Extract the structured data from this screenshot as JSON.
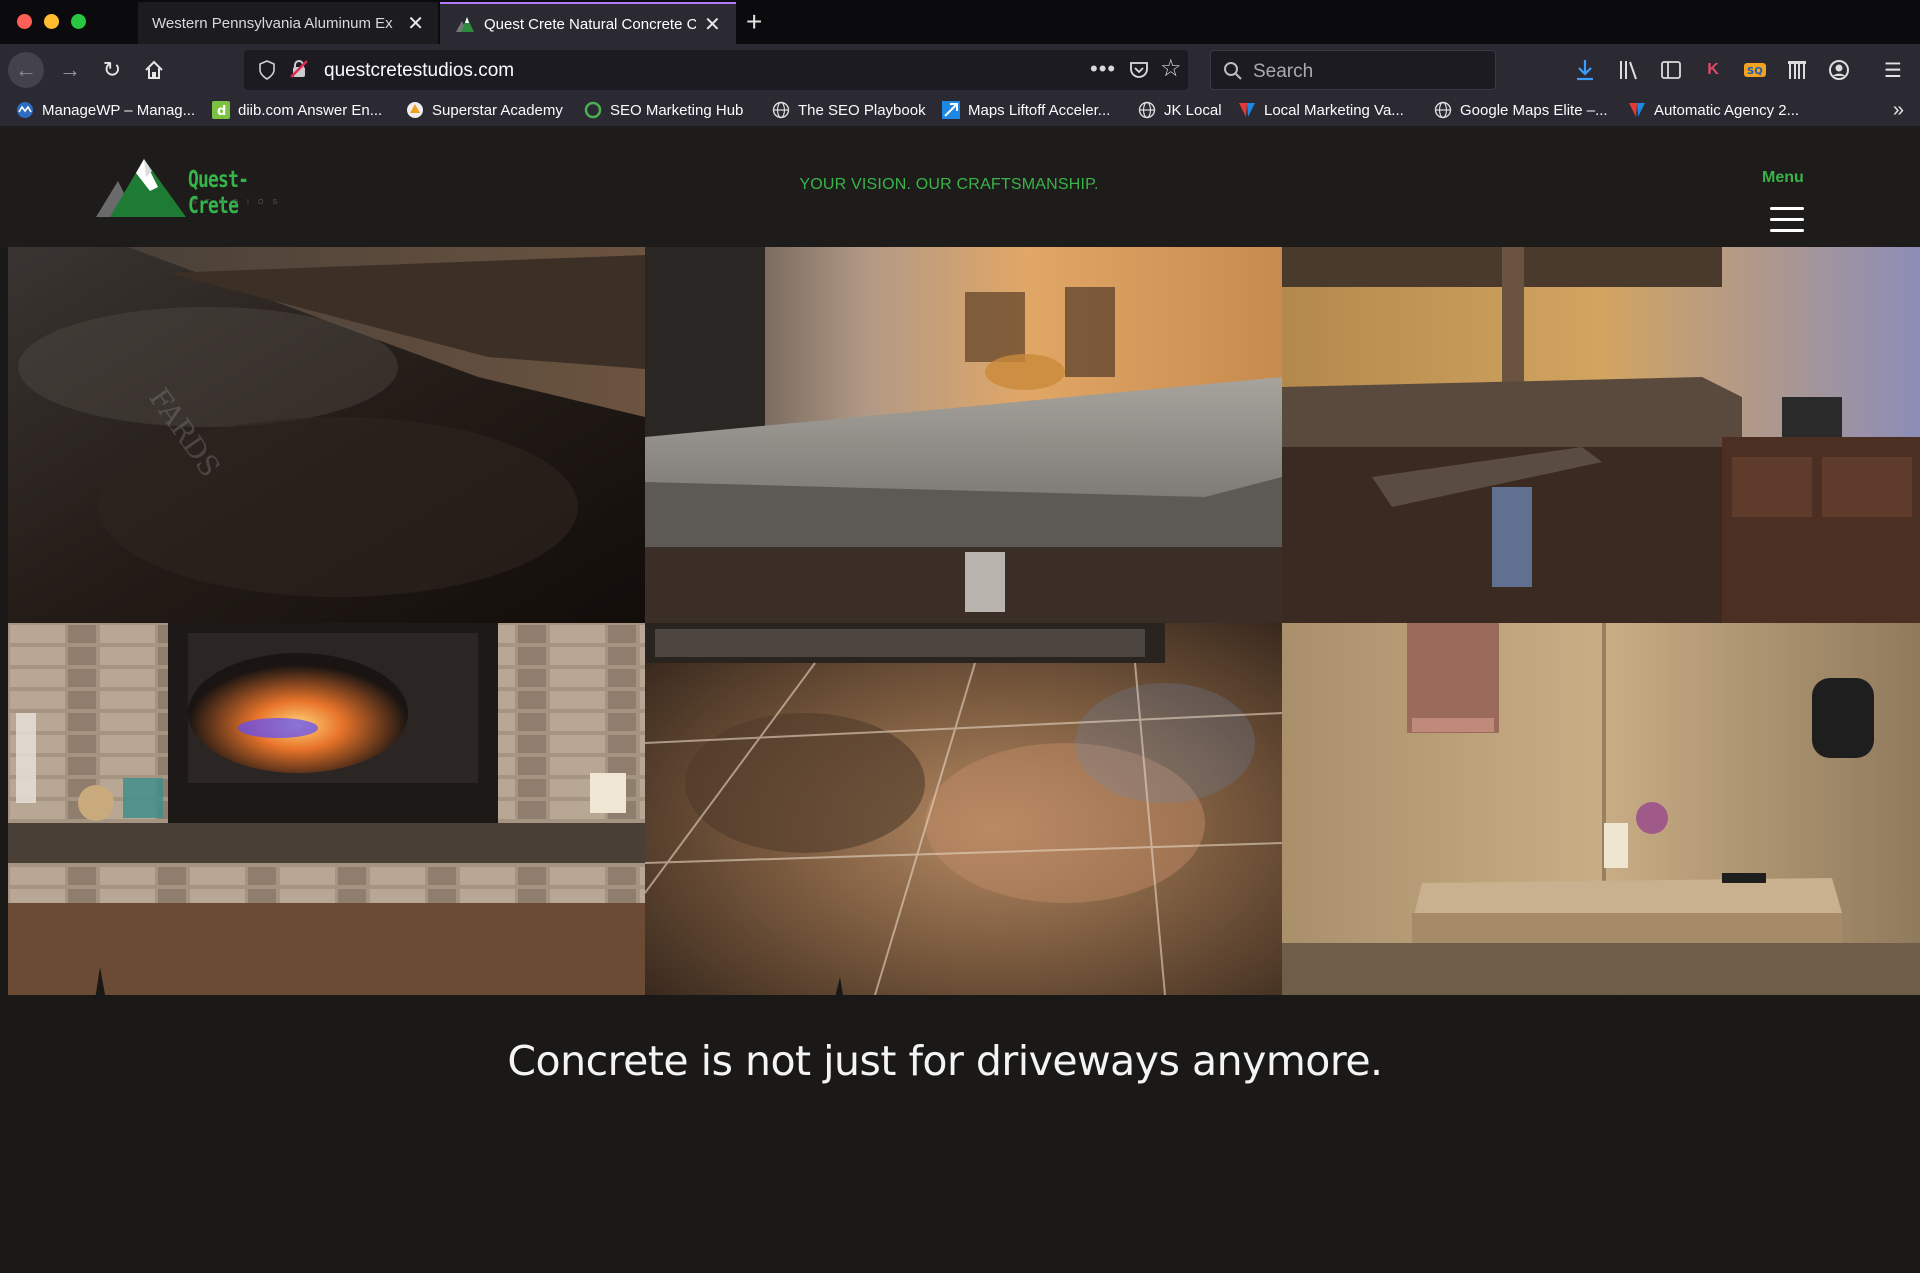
{
  "browser": {
    "tabs": [
      {
        "label": "Western Pennsylvania Aluminum Ex",
        "active": false
      },
      {
        "label": "Quest Crete Natural Concrete C",
        "active": true
      }
    ],
    "url": "questcretestudios.com",
    "search_placeholder": "Search",
    "bookmarks": [
      {
        "label": "ManageWP – Manag...",
        "icon": "managewp-icon"
      },
      {
        "label": "diib.com Answer En...",
        "icon": "diib-icon"
      },
      {
        "label": "Superstar Academy",
        "icon": "superstar-icon"
      },
      {
        "label": "SEO Marketing Hub",
        "icon": "seo-hub-icon"
      },
      {
        "label": "The SEO Playbook",
        "icon": "globe-icon"
      },
      {
        "label": "Maps Liftoff Acceler...",
        "icon": "maps-liftoff-icon"
      },
      {
        "label": "JK Local",
        "icon": "globe-icon"
      },
      {
        "label": "Local Marketing Va...",
        "icon": "local-marketing-icon"
      },
      {
        "label": "Google Maps Elite –...",
        "icon": "globe-icon"
      },
      {
        "label": "Automatic Agency 2...",
        "icon": "automatic-agency-icon"
      }
    ]
  },
  "site": {
    "logo_text": "Quest-Crete",
    "logo_sub": "STUDIOS",
    "tagline": "YOUR VISION. OUR CRAFTSMANSHIP.",
    "menu_label": "Menu",
    "headline": "Concrete is not just for driveways anymore.",
    "gallery": [
      {
        "name": "concrete-countertop-closeup"
      },
      {
        "name": "kitchen-countertop-edge"
      },
      {
        "name": "basement-bar-counter"
      },
      {
        "name": "fireplace-hearth"
      },
      {
        "name": "stained-concrete-floor"
      },
      {
        "name": "textured-wall-bench"
      }
    ],
    "colors": {
      "brand_green": "#3ab34a",
      "background": "#1a1917"
    }
  }
}
